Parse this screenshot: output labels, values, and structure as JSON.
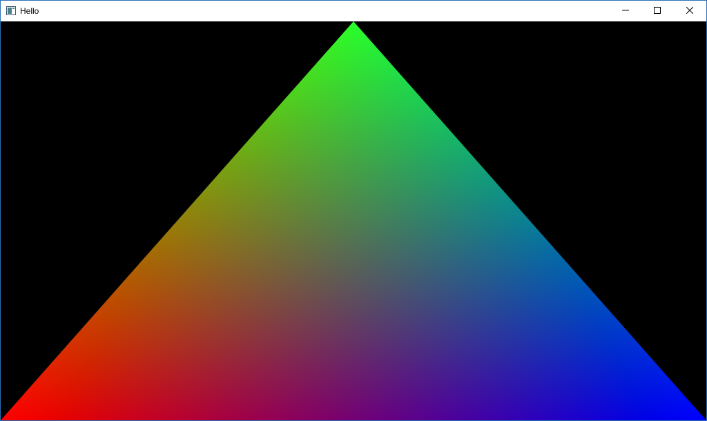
{
  "window": {
    "title": "Hello",
    "icons": {
      "app": "app-window-icon",
      "minimize": "minimize-icon",
      "maximize": "maximize-icon",
      "close": "close-icon"
    }
  },
  "scene": {
    "background_color": "#000000",
    "triangle": {
      "vertex_colors": {
        "top": "#00ff00",
        "bottom_left": "#ff0000",
        "bottom_right": "#0000ff"
      }
    }
  }
}
